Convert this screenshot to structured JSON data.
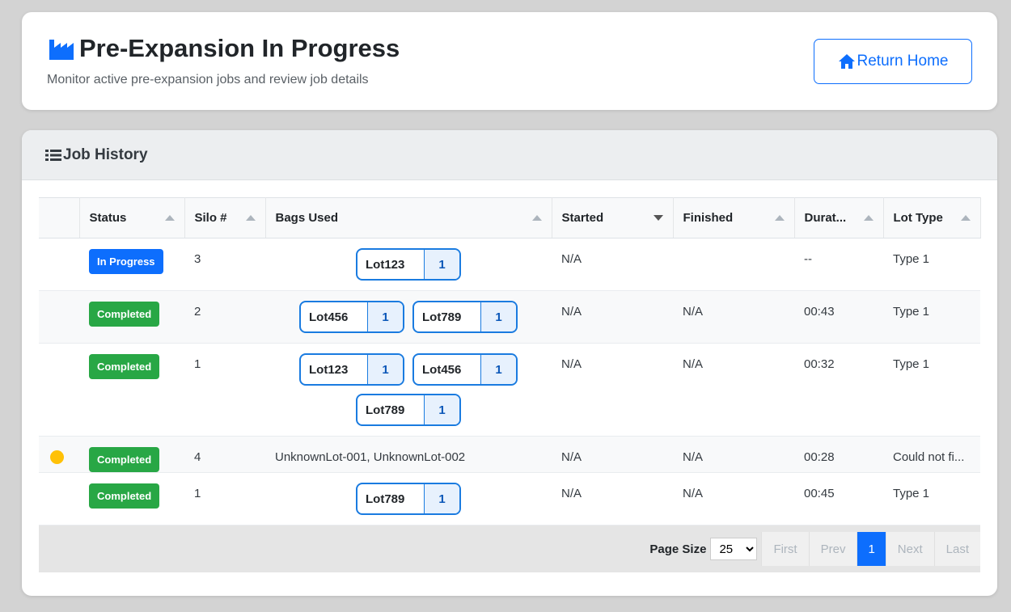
{
  "header": {
    "title": "Pre-Expansion In Progress",
    "subtitle": "Monitor active pre-expansion jobs and review job details",
    "return_label": "Return Home"
  },
  "history": {
    "title": "Job History",
    "columns": [
      "",
      "Status",
      "Silo #",
      "Bags Used",
      "Started",
      "Finished",
      "Durat...",
      "Lot Type"
    ],
    "rows": [
      {
        "flag": false,
        "status": "In Progress",
        "status_kind": "progress",
        "silo": "3",
        "bags": [
          {
            "lot": "Lot123",
            "qty": "1"
          }
        ],
        "bags_text": "",
        "started": "N/A",
        "finished": "",
        "duration": "--",
        "lot_type": "Type 1"
      },
      {
        "flag": false,
        "status": "Completed",
        "status_kind": "complete",
        "silo": "2",
        "bags": [
          {
            "lot": "Lot456",
            "qty": "1"
          },
          {
            "lot": "Lot789",
            "qty": "1"
          }
        ],
        "bags_text": "",
        "started": "N/A",
        "finished": "N/A",
        "duration": "00:43",
        "lot_type": "Type 1"
      },
      {
        "flag": false,
        "status": "Completed",
        "status_kind": "complete",
        "silo": "1",
        "bags": [
          {
            "lot": "Lot123",
            "qty": "1"
          },
          {
            "lot": "Lot456",
            "qty": "1"
          },
          {
            "lot": "Lot789",
            "qty": "1"
          }
        ],
        "bags_text": "",
        "started": "N/A",
        "finished": "N/A",
        "duration": "00:32",
        "lot_type": "Type 1"
      },
      {
        "flag": true,
        "status": "Completed",
        "status_kind": "complete",
        "silo": "4",
        "bags": [],
        "bags_text": "UnknownLot-001, UnknownLot-002",
        "started": "N/A",
        "finished": "N/A",
        "duration": "00:28",
        "lot_type": "Could not fi..."
      },
      {
        "flag": false,
        "status": "Completed",
        "status_kind": "complete",
        "silo": "1",
        "bags": [
          {
            "lot": "Lot789",
            "qty": "1"
          }
        ],
        "bags_text": "",
        "started": "N/A",
        "finished": "N/A",
        "duration": "00:45",
        "lot_type": "Type 1"
      }
    ]
  },
  "pager": {
    "page_size_label": "Page Size",
    "page_size": "25",
    "first": "First",
    "prev": "Prev",
    "current": "1",
    "next": "Next",
    "last": "Last"
  },
  "colors": {
    "accent": "#0d6efd",
    "completed": "#28a745",
    "warning_dot": "#ffc107"
  },
  "icons": [
    "factory-icon",
    "home-icon",
    "list-icon"
  ]
}
